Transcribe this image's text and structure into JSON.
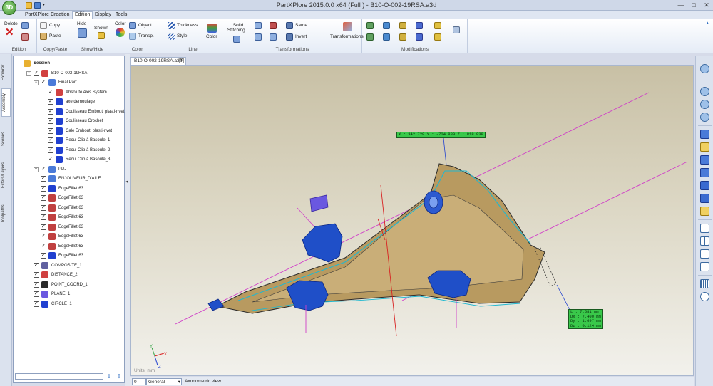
{
  "app": {
    "logo_text": "3D",
    "title": "PartXPlore 2015.0.0 x64 (Full ) - B10-O-002-19RSA.a3d",
    "win_minimize": "—",
    "win_maximize": "□",
    "win_close": "✕"
  },
  "menu": {
    "tabs": [
      "PartXPlore",
      "Creation",
      "Edition",
      "Display",
      "Tools"
    ],
    "active": "Edition"
  },
  "ribbon": {
    "groups": {
      "edition": "Edition",
      "copy_paste": "Copy/Paste",
      "show_hide": "Show/Hide",
      "color": "Color",
      "line": "Line",
      "transformations": "Transformations",
      "modifications": "Modifications"
    },
    "buttons": {
      "delete": "Delete",
      "copy": "Copy",
      "paste": "Paste",
      "hide": "Hide",
      "shown": "Shown",
      "color_small": "Color",
      "object": "Object",
      "transp": "Transp.",
      "thickness": "Thickness",
      "style": "Style",
      "line_color": "Color",
      "solid_stitching": "Solid Stitching...",
      "same": "Same",
      "invert": "Invert",
      "transformations": "Transformations"
    }
  },
  "side_tabs": [
    "Explorer",
    "Assembly",
    "Scenes",
    "Filters/Layers",
    "Toolpaths"
  ],
  "side_tab_active": "Assembly",
  "tree": [
    {
      "label": "Session",
      "level": 0,
      "bold": true,
      "icon": "session-icon"
    },
    {
      "label": "B10-O-002-19RSA",
      "level": 1,
      "icon": "part-icon"
    },
    {
      "label": "Final Part",
      "level": 2,
      "icon": "solid-icon"
    },
    {
      "label": "Absolute Axis System",
      "level": 3,
      "icon": "axis-system-icon"
    },
    {
      "label": "axe demoulage",
      "level": 3,
      "icon": "line-icon"
    },
    {
      "label": "Coulisseau Embouti plasti-rivet",
      "level": 3,
      "icon": "line-icon"
    },
    {
      "label": "Coulisseau Crochet",
      "level": 3,
      "icon": "line-icon"
    },
    {
      "label": "Cale Embouti plasti-rivet",
      "level": 3,
      "icon": "line-icon"
    },
    {
      "label": "Recul Clip à Basoule_1",
      "level": 3,
      "icon": "line-icon"
    },
    {
      "label": "Recul Clip à Basoule_2",
      "level": 3,
      "icon": "line-icon"
    },
    {
      "label": "Recul Clip à Basoule_3",
      "level": 3,
      "icon": "line-icon"
    },
    {
      "label": "PDJ",
      "level": 2,
      "icon": "solid-icon"
    },
    {
      "label": "ENJOLIVEUR_D'AILE",
      "level": 2,
      "icon": "solid-icon"
    },
    {
      "label": "EdgeFillet.63",
      "level": 2,
      "icon": "edge-icon"
    },
    {
      "label": "EdgeFillet.63",
      "level": 2,
      "icon": "curve-icon"
    },
    {
      "label": "EdgeFillet.63",
      "level": 2,
      "icon": "curve-icon"
    },
    {
      "label": "EdgeFillet.63",
      "level": 2,
      "icon": "curve-icon"
    },
    {
      "label": "EdgeFillet.63",
      "level": 2,
      "icon": "curve-icon"
    },
    {
      "label": "EdgeFillet.63",
      "level": 2,
      "icon": "curve-icon"
    },
    {
      "label": "EdgeFillet.63",
      "level": 2,
      "icon": "curve-icon"
    },
    {
      "label": "EdgeFillet.63",
      "level": 2,
      "icon": "edge-icon"
    },
    {
      "label": "COMPOSITE_1",
      "level": 1,
      "icon": "composite-icon"
    },
    {
      "label": "DISTANCE_2",
      "level": 1,
      "icon": "distance-icon"
    },
    {
      "label": "POINT_COORD_1",
      "level": 1,
      "icon": "point-icon"
    },
    {
      "label": "PLANE_1",
      "level": 1,
      "icon": "plane-icon"
    },
    {
      "label": "CIRCLE_1",
      "level": 1,
      "icon": "circle-icon"
    }
  ],
  "document_tab": "B10-O-002-19RSA.a3d",
  "viewport": {
    "units": "Units: mm",
    "point_coord": "X : 342.729 Y : -724.889 Z : 818.938",
    "distance": "L : 7.581 mm\nDx : 7.400 mm\nDy : 1.697 mm\nDz : 0.124 mm",
    "triad_x": "X",
    "triad_y": "Y",
    "triad_z": "Z"
  },
  "status": {
    "layer": "0",
    "filter": "General",
    "view": "Axonometric view"
  },
  "colors": {
    "part_body": "#a88a55",
    "part_edge": "#2a2a2a",
    "clip_blue": "#1f4fc8",
    "magenta": "#d040c8",
    "red_axis": "#d82020",
    "cyan": "#20b8d0",
    "label_green": "#39c84a",
    "ribbon_bg": "#e5ecf6"
  }
}
